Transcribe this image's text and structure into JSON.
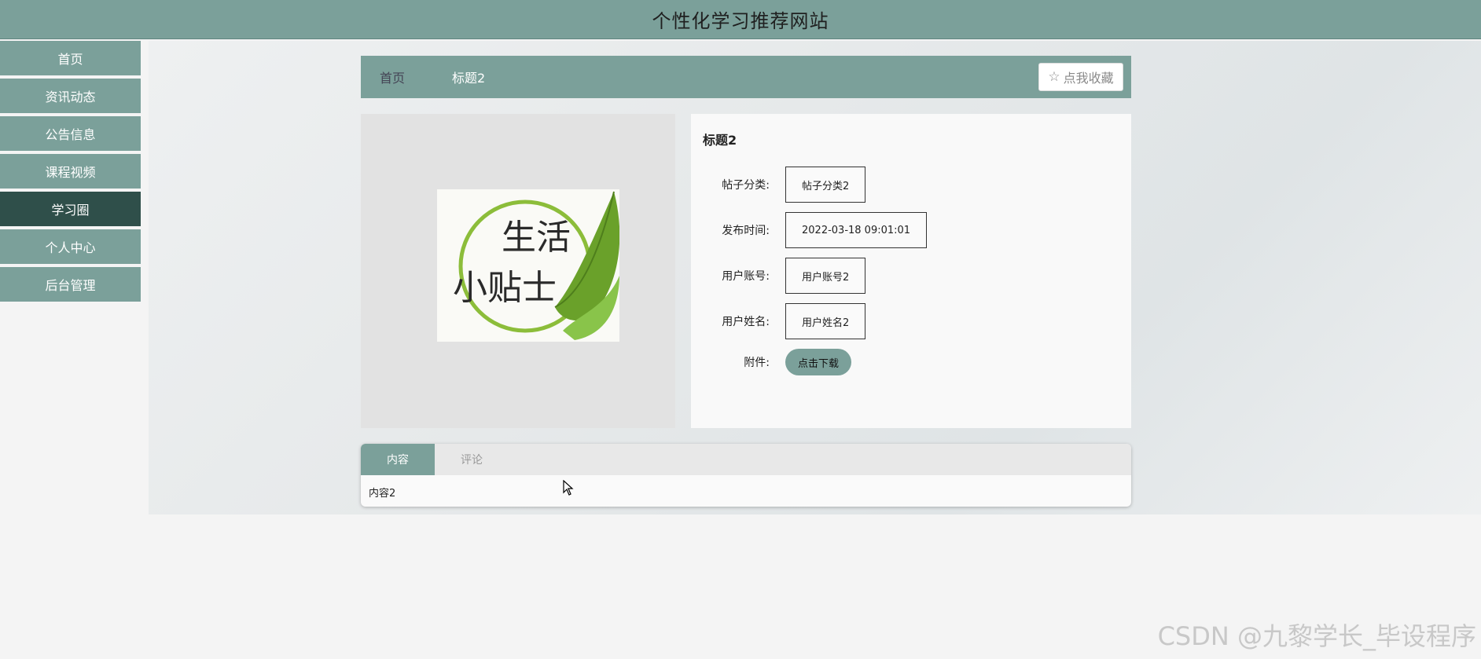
{
  "site": {
    "title": "个性化学习推荐网站"
  },
  "sidebar": {
    "items": [
      {
        "label": "首页"
      },
      {
        "label": "资讯动态"
      },
      {
        "label": "公告信息"
      },
      {
        "label": "课程视频"
      },
      {
        "label": "学习圈",
        "active": true
      },
      {
        "label": "个人中心"
      },
      {
        "label": "后台管理"
      }
    ]
  },
  "breadcrumb": {
    "home": "首页",
    "current": "标题2"
  },
  "favorite": {
    "icon": "star-outline-icon",
    "label": "点我收藏"
  },
  "detail": {
    "title": "标题2",
    "fields": [
      {
        "label": "帖子分类:",
        "value": "帖子分类2"
      },
      {
        "label": "发布时间:",
        "value": "2022-03-18 09:01:01"
      },
      {
        "label": "用户账号:",
        "value": "用户账号2"
      },
      {
        "label": "用户姓名:",
        "value": "用户姓名2"
      }
    ],
    "attachment": {
      "label": "附件:",
      "button": "点击下载"
    }
  },
  "cover": {
    "text_line1": "生活",
    "text_line2": "小贴士"
  },
  "tabs": {
    "items": [
      {
        "label": "内容"
      },
      {
        "label": "评论"
      }
    ],
    "content": "内容2"
  },
  "watermark": "CSDN @九黎学长_毕设程序",
  "colors": {
    "accent": "#7ba09a",
    "active_nav": "#2f4f4a"
  }
}
